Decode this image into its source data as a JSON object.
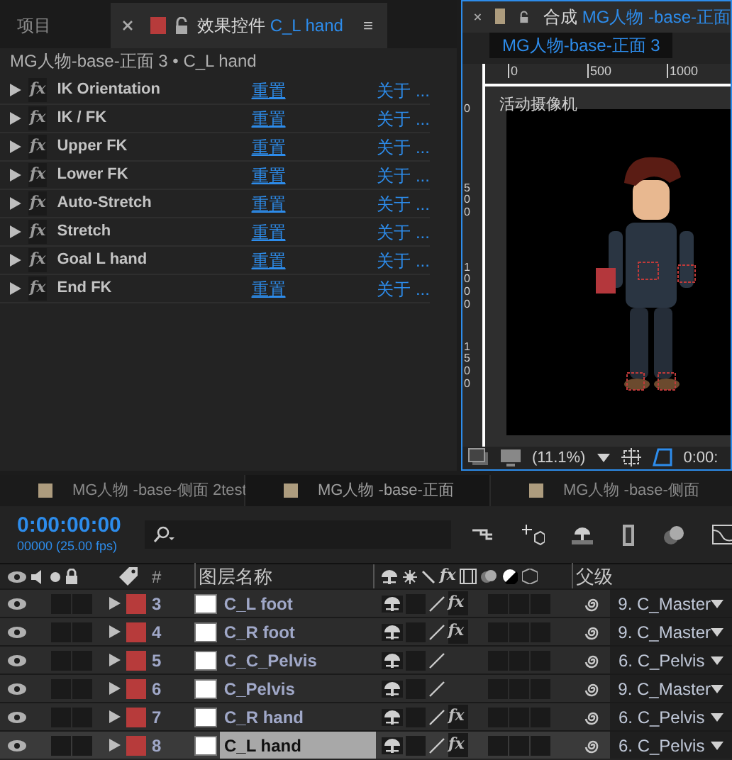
{
  "project_tab": {
    "label": "项目",
    "selected": false
  },
  "effects_panel": {
    "tab_label": "效果控件",
    "layer": "C_L hand",
    "menu": "≡",
    "selected": true,
    "breadcrumb": "MG人物-base-正面 3 • C_L hand",
    "effects": [
      {
        "badge": "fx",
        "name": "IK Orientation",
        "reset": "重置",
        "about": "关于 ..."
      },
      {
        "badge": "fx",
        "name": "IK / FK",
        "reset": "重置",
        "about": "关于 ..."
      },
      {
        "badge": "fx",
        "name": "Upper FK",
        "reset": "重置",
        "about": "关于 ..."
      },
      {
        "badge": "fx",
        "name": "Lower FK",
        "reset": "重置",
        "about": "关于 ..."
      },
      {
        "badge": "fx",
        "name": "Auto-Stretch",
        "reset": "重置",
        "about": "关于 ..."
      },
      {
        "badge": "fx",
        "name": "Stretch",
        "reset": "重置",
        "about": "关于 ..."
      },
      {
        "badge": "fx",
        "name": "Goal L hand",
        "reset": "重置",
        "about": "关于 ..."
      },
      {
        "badge": "fx",
        "name": "End FK",
        "reset": "重置",
        "about": "关于 ..."
      }
    ]
  },
  "comp_panel": {
    "tab_label": "合成",
    "comp_name": "MG人物 -base-正面",
    "subtab": "MG人物-base-正面 3",
    "ruler_h": [
      "0",
      "500",
      "1000"
    ],
    "ruler_v": [
      "0",
      "500",
      "1000",
      "1500"
    ],
    "camera": "活动摄像机",
    "zoom": "(11.1%)",
    "time": "0:00:"
  },
  "timeline": {
    "tabs": [
      {
        "label": "MG人物 -base-侧面  2test",
        "selected": false
      },
      {
        "label": "MG人物 -base-正面",
        "selected": true
      },
      {
        "label": "MG人物 -base-侧面",
        "selected": false
      }
    ],
    "timecode": "0:00:00:00",
    "frames": "00000 (25.00 fps)",
    "columns": {
      "number": "#",
      "name": "图层名称",
      "fx": "fx",
      "parent": "父级"
    },
    "layers": [
      {
        "number": "3",
        "name": "C_L foot",
        "fx": "fx",
        "parent": "9. C_Master",
        "selected": false
      },
      {
        "number": "4",
        "name": "C_R foot",
        "fx": "fx",
        "parent": "9. C_Master",
        "selected": false
      },
      {
        "number": "5",
        "name": "C_C_Pelvis",
        "parent": "6. C_Pelvis",
        "selected": false
      },
      {
        "number": "6",
        "name": "C_Pelvis",
        "parent": "9. C_Master",
        "selected": false
      },
      {
        "number": "7",
        "name": "C_R hand",
        "fx": "fx",
        "parent": "6. C_Pelvis",
        "selected": false
      },
      {
        "number": "8",
        "name": "C_L hand",
        "fx": "fx",
        "parent": "6. C_Pelvis",
        "selected": true
      }
    ]
  }
}
